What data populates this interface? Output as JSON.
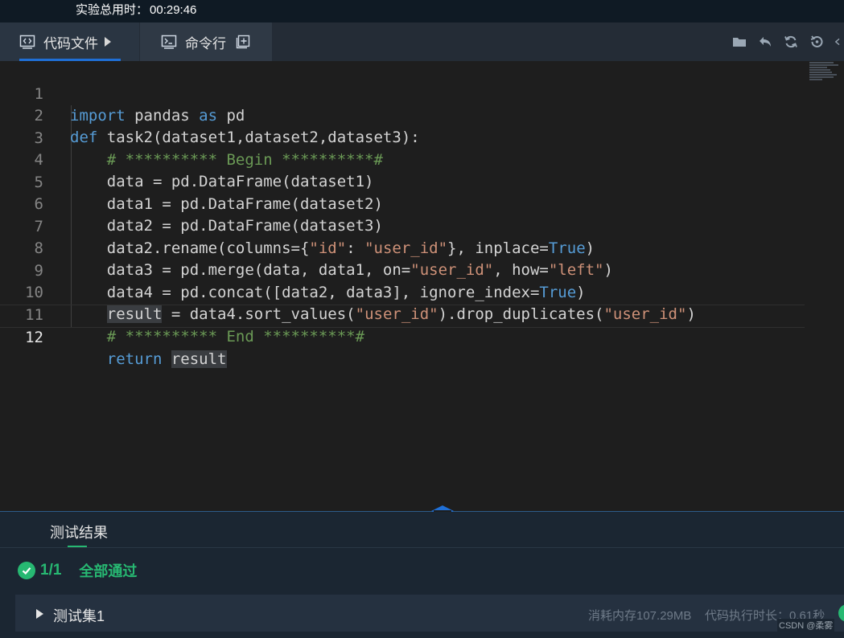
{
  "topbar": {
    "timer_label": "实验总用时：",
    "timer_value": "00:29:46"
  },
  "tabs": [
    {
      "label": "代码文件",
      "icon": "code-file-icon",
      "active": true
    },
    {
      "label": "命令行",
      "icon": "terminal-icon",
      "active": false
    }
  ],
  "toolbar": {
    "icons": [
      "folder-icon",
      "undo-icon",
      "refresh-icon",
      "reset-icon",
      "more-icon"
    ]
  },
  "editor": {
    "current_line": 12,
    "lines": [
      {
        "n": "1",
        "text": "import pandas as pd"
      },
      {
        "n": "2",
        "text": "def task2(dataset1,dataset2,dataset3):"
      },
      {
        "n": "3",
        "text": "    # ********** Begin **********#"
      },
      {
        "n": "4",
        "text": "    data = pd.DataFrame(dataset1)"
      },
      {
        "n": "5",
        "text": "    data1 = pd.DataFrame(dataset2)"
      },
      {
        "n": "6",
        "text": "    data2 = pd.DataFrame(dataset3)"
      },
      {
        "n": "7",
        "text": "    data2.rename(columns={\"id\": \"user_id\"}, inplace=True)"
      },
      {
        "n": "8",
        "text": "    data3 = pd.merge(data, data1, on=\"user_id\", how=\"left\")"
      },
      {
        "n": "9",
        "text": "    data4 = pd.concat([data2, data3], ignore_index=True)"
      },
      {
        "n": "10",
        "text": "    result = data4.sort_values(\"user_id\").drop_duplicates(\"user_id\")"
      },
      {
        "n": "11",
        "text": "    # ********** End **********#"
      },
      {
        "n": "12",
        "text": "    return result"
      }
    ]
  },
  "results": {
    "tab_label": "测试结果",
    "score": "1/1",
    "status": "全部通过",
    "testset": {
      "name": "测试集1",
      "memory": "消耗内存107.29MB",
      "time": "代码执行时长：0.61秒"
    }
  },
  "watermark": "CSDN @柔雾",
  "colors": {
    "accent_green": "#27b872",
    "accent_blue": "#1f6fd6"
  }
}
